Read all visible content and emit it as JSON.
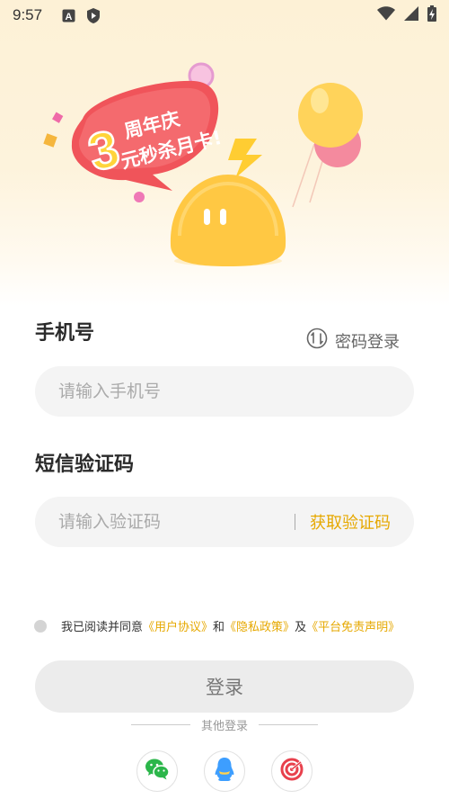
{
  "status_bar": {
    "time": "9:57"
  },
  "banner": {
    "number": "3",
    "line1": "周年庆",
    "line2": "元秒杀月卡!"
  },
  "phone": {
    "label": "手机号",
    "placeholder": "请输入手机号",
    "value": ""
  },
  "password_login": {
    "label": "密码登录"
  },
  "sms": {
    "label": "短信验证码",
    "placeholder": "请输入验证码",
    "value": "",
    "get_code": "获取验证码"
  },
  "agreement": {
    "prefix": "我已阅读并同意",
    "user_agreement": "《用户协议》",
    "and": "和",
    "privacy_policy": "《隐私政策》",
    "and2": "及",
    "disclaimer": "《平台免责声明》",
    "checked": false
  },
  "login_button": {
    "label": "登录"
  },
  "other_login": {
    "label": "其他登录"
  },
  "social_icons": [
    "wechat-icon",
    "qq-icon",
    "weibo-icon"
  ],
  "colors": {
    "accent": "#e6a800",
    "banner_red": "#f0545a",
    "mascot_yellow": "#ffc843"
  }
}
